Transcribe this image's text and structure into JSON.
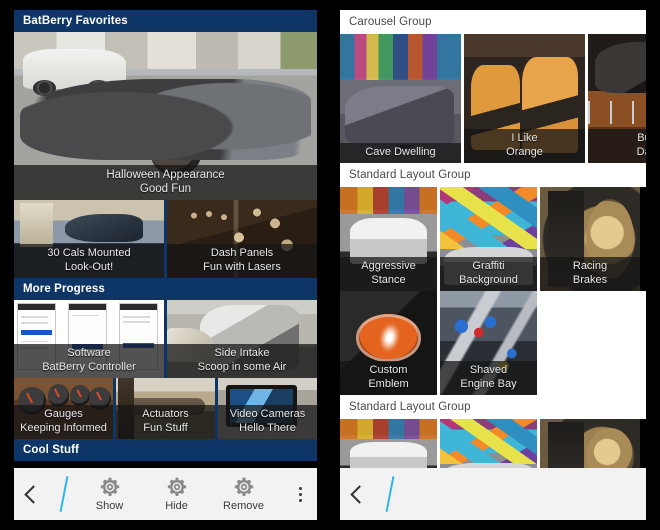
{
  "app": {
    "left_panel_name": "media-gallery-left",
    "right_panel_name": "media-gallery-right"
  },
  "left_panel": {
    "sections": [
      {
        "title": "BatBerry Favorites",
        "style": "dark",
        "tiles": [
          {
            "title": "Halloween Appearance",
            "subtitle": "Good Fun",
            "art": "ph-bat"
          },
          {
            "title": "30 Cals Mounted",
            "subtitle": "Look-Out!",
            "art": "ph-cals"
          },
          {
            "title": "Dash Panels",
            "subtitle": "Fun with Lasers",
            "art": "ph-dash"
          }
        ]
      },
      {
        "title": "More Progress",
        "style": "dark",
        "tiles": [
          {
            "title": "Software",
            "subtitle": "BatBerry Controller",
            "art": "ph-soft"
          },
          {
            "title": "Side Intake",
            "subtitle": "Scoop in some Air",
            "art": "ph-intake"
          },
          {
            "title": "Gauges",
            "subtitle": "Keeping Informed",
            "art": "ph-gauge"
          },
          {
            "title": "Actuators",
            "subtitle": "Fun Stuff",
            "art": "ph-act"
          },
          {
            "title": "Video Cameras",
            "subtitle": "Hello There",
            "art": "ph-vid"
          }
        ]
      },
      {
        "title": "Cool Stuff",
        "style": "dark",
        "tiles": []
      }
    ],
    "toolbar": {
      "back_label": "back",
      "actions": [
        {
          "label": "Show",
          "icon": "gear-icon"
        },
        {
          "label": "Hide",
          "icon": "gear-icon"
        },
        {
          "label": "Remove",
          "icon": "gear-icon"
        }
      ],
      "overflow_label": "more-options",
      "accent_color": "#2fb6e8"
    }
  },
  "right_panel": {
    "sections": [
      {
        "title": "Carousel Group",
        "style": "light",
        "tiles": [
          {
            "title": "Cave Dwelling",
            "subtitle": "",
            "art": "ph-cave"
          },
          {
            "title": "I Like",
            "subtitle": "Orange",
            "art": "ph-orange"
          },
          {
            "title": "Bum",
            "subtitle": "Da T",
            "art": "ph-bump"
          }
        ]
      },
      {
        "title": "Standard Layout Group",
        "style": "light",
        "tiles": [
          {
            "title": "Aggressive",
            "subtitle": "Stance",
            "art": "ph-agg"
          },
          {
            "title": "Graffiti",
            "subtitle": "Background",
            "art": "ph-graf"
          },
          {
            "title": "Racing",
            "subtitle": "Brakes",
            "art": "ph-brake"
          },
          {
            "title": "Custom",
            "subtitle": "Emblem",
            "art": "ph-emblem"
          },
          {
            "title": "Shaved",
            "subtitle": "Engine Bay",
            "art": "ph-engine"
          }
        ]
      },
      {
        "title": "Standard Layout Group",
        "style": "light",
        "tiles": [
          {
            "title": "",
            "subtitle": "",
            "art": "ph-agg"
          },
          {
            "title": "",
            "subtitle": "",
            "art": "ph-graf"
          },
          {
            "title": "",
            "subtitle": "",
            "art": "ph-brake"
          }
        ]
      }
    ],
    "toolbar": {
      "back_label": "back",
      "accent_color": "#2fb6e8"
    }
  },
  "colors": {
    "header_dark_bg": "#0d3566",
    "header_dark_text": "#ffffff",
    "header_light_bg": "#ffffff",
    "header_light_text": "#4a4a4a",
    "toolbar_bg": "#f2f2f2",
    "caption_text": "#e9e9e9",
    "page_bg": "#000000"
  }
}
